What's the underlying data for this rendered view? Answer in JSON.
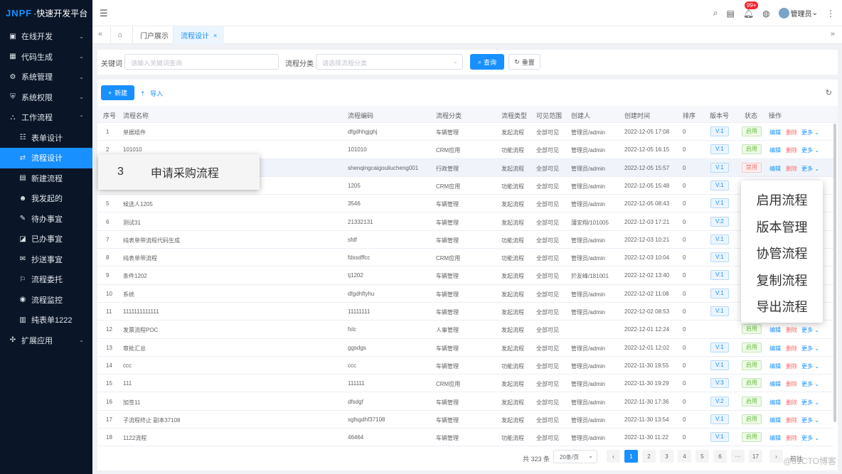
{
  "app": {
    "brand": "JNPF",
    "title": "·快速开发平台"
  },
  "sidebar": {
    "items": [
      {
        "label": "在线开发",
        "icon": "monitor-icon",
        "glyph": "▣",
        "chevron": "⌄",
        "sub": false,
        "active": false
      },
      {
        "label": "代码生成",
        "icon": "code-icon",
        "glyph": "▦",
        "chevron": "⌄",
        "sub": false,
        "active": false
      },
      {
        "label": "系统管理",
        "icon": "gear-icon",
        "glyph": "⚙",
        "chevron": "⌄",
        "sub": false,
        "active": false
      },
      {
        "label": "系统权限",
        "icon": "shield-icon",
        "glyph": "⛨",
        "chevron": "⌄",
        "sub": false,
        "active": false
      },
      {
        "label": "工作流程",
        "icon": "workflow-icon",
        "glyph": "⛬",
        "chevron": "⌃",
        "sub": false,
        "active": false
      },
      {
        "label": "表单设计",
        "icon": "form-icon",
        "glyph": "☷",
        "chevron": "",
        "sub": true,
        "active": false
      },
      {
        "label": "流程设计",
        "icon": "flow-design-icon",
        "glyph": "⇄",
        "chevron": "",
        "sub": true,
        "active": true
      },
      {
        "label": "新建流程",
        "icon": "new-flow-icon",
        "glyph": "▤",
        "chevron": "",
        "sub": true,
        "active": false
      },
      {
        "label": "我发起的",
        "icon": "user-icon",
        "glyph": "☻",
        "chevron": "",
        "sub": true,
        "active": false
      },
      {
        "label": "待办事宜",
        "icon": "todo-icon",
        "glyph": "✎",
        "chevron": "",
        "sub": true,
        "active": false
      },
      {
        "label": "已办事宜",
        "icon": "done-icon",
        "glyph": "◪",
        "chevron": "",
        "sub": true,
        "active": false
      },
      {
        "label": "抄送事宜",
        "icon": "cc-icon",
        "glyph": "✉",
        "chevron": "",
        "sub": true,
        "active": false
      },
      {
        "label": "流程委托",
        "icon": "delegate-icon",
        "glyph": "⚐",
        "chevron": "",
        "sub": true,
        "active": false
      },
      {
        "label": "流程监控",
        "icon": "monitor-flow-icon",
        "glyph": "◉",
        "chevron": "",
        "sub": true,
        "active": false
      },
      {
        "label": "纯表单1222",
        "icon": "doc-icon",
        "glyph": "▥",
        "chevron": "",
        "sub": true,
        "active": false
      },
      {
        "label": "扩展应用",
        "icon": "extend-icon",
        "glyph": "✣",
        "chevron": "⌄",
        "sub": false,
        "active": false
      }
    ]
  },
  "header": {
    "badge": "99+",
    "user": "管理员",
    "user_chev": "⌄"
  },
  "tabs": [
    {
      "label": "门户展示",
      "active": false
    },
    {
      "label": "流程设计",
      "active": true,
      "close": "×"
    }
  ],
  "search": {
    "keyword_label": "关键词",
    "keyword_placeholder": "请输入关键词查询",
    "category_label": "流程分类",
    "category_placeholder": "请选择流程分类",
    "query_button": "查询",
    "reset_button": "重置"
  },
  "toolbar": {
    "new_button": "新建",
    "import_button": "导入"
  },
  "table": {
    "columns": [
      "序号",
      "流程名称",
      "流程编码",
      "流程分类",
      "流程类型",
      "可见范围",
      "创建人",
      "创建时间",
      "排序",
      "版本号",
      "状态",
      "操作"
    ],
    "rows": [
      [
        "1",
        "单据组件",
        "dfgdhhgjghj",
        "车辆管理",
        "发起流程",
        "全部可见",
        "管理员/admin",
        "2022-12-05 17:08",
        "0",
        "V:1",
        "启用"
      ],
      [
        "2",
        "101010",
        "101010",
        "CRM应用",
        "功能流程",
        "全部可见",
        "管理员/admin",
        "2022-12-05 16:15",
        "0",
        "V:1",
        "启用"
      ],
      [
        "3",
        "申请采购流程",
        "shenqingcaigouliucheng001",
        "行政管理",
        "发起流程",
        "全部可见",
        "管理员/admin",
        "2022-12-05 15:57",
        "0",
        "V:1",
        "禁用"
      ],
      [
        "4",
        "",
        "1205",
        "CRM应用",
        "功能流程",
        "全部可见",
        "管理员/admin",
        "2022-12-05 15:48",
        "0",
        "V:1",
        ""
      ],
      [
        "5",
        "候选人1205",
        "3546",
        "车辆管理",
        "发起流程",
        "全部可见",
        "管理员/admin",
        "2022-12-05 08:43",
        "0",
        "V:1",
        ""
      ],
      [
        "6",
        "测试31",
        "21332131",
        "车辆管理",
        "发起流程",
        "全部可见",
        "蒲安翔/101005",
        "2022-12-03 17:21",
        "0",
        "V:2",
        ""
      ],
      [
        "7",
        "纯表单带流程代码生成",
        "sfdf",
        "车辆管理",
        "功能流程",
        "全部可见",
        "管理员/admin",
        "2022-12-03 10:21",
        "0",
        "V:1",
        ""
      ],
      [
        "8",
        "纯表单带流程",
        "fdssdffcc",
        "CRM应用",
        "功能流程",
        "全部可见",
        "管理员/admin",
        "2022-12-03 10:04",
        "0",
        "V:1",
        ""
      ],
      [
        "9",
        "条件1202",
        "tj1202",
        "车辆管理",
        "发起流程",
        "全部可见",
        "於友峰/181001",
        "2022-12-02 13:40",
        "0",
        "V:1",
        ""
      ],
      [
        "10",
        "系统",
        "dfgdhftyhu",
        "车辆管理",
        "发起流程",
        "全部可见",
        "管理员/admin",
        "2022-12-02 11:08",
        "0",
        "V:1",
        ""
      ],
      [
        "11",
        "1111111111111",
        "11111111",
        "车辆管理",
        "发起流程",
        "全部可见",
        "管理员/admin",
        "2022-12-02 08:53",
        "0",
        "V:1",
        ""
      ],
      [
        "12",
        "发票流程POC",
        "fxlc",
        "人事管理",
        "发起流程",
        "全部可见",
        "",
        "2022-12-01 12:24",
        "0",
        "",
        "启用"
      ],
      [
        "13",
        "审批汇总",
        "ggsdgs",
        "车辆管理",
        "发起流程",
        "全部可见",
        "管理员/admin",
        "2022-12-01 12:02",
        "0",
        "V:1",
        "启用"
      ],
      [
        "14",
        "ccc",
        "ccc",
        "车辆管理",
        "功能流程",
        "全部可见",
        "管理员/admin",
        "2022-11-30 19:55",
        "0",
        "V:1",
        "启用"
      ],
      [
        "15",
        "111",
        "111111",
        "CRM应用",
        "发起流程",
        "全部可见",
        "管理员/admin",
        "2022-11-30 19:29",
        "0",
        "V:3",
        "启用"
      ],
      [
        "16",
        "加签11",
        "dfsdgf",
        "车辆管理",
        "发起流程",
        "全部可见",
        "管理员/admin",
        "2022-11-30 17:36",
        "0",
        "V:2",
        "启用"
      ],
      [
        "17",
        "子流程终止 副本37108",
        "sgfsgdhf37108",
        "车辆管理",
        "发起流程",
        "全部可见",
        "管理员/admin",
        "2022-11-30 13:54",
        "0",
        "V:1",
        "启用"
      ],
      [
        "18",
        "1122流程",
        "46464",
        "车辆管理",
        "功能流程",
        "全部可见",
        "管理员/admin",
        "2022-11-30 11:22",
        "0",
        "V:1",
        "启用"
      ]
    ],
    "ops": {
      "edit": "编辑",
      "delete": "删除",
      "more": "更多 ⌄"
    }
  },
  "pagination": {
    "total": "共 323 条",
    "page_size": "20条/页",
    "pages": [
      "1",
      "2",
      "3",
      "4",
      "5",
      "6",
      "···",
      "17"
    ],
    "current": "1",
    "goto": "前往"
  },
  "callout": {
    "num": "3",
    "text": "申请采购流程"
  },
  "dropdown": [
    "启用流程",
    "版本管理",
    "协管流程",
    "复制流程",
    "导出流程"
  ],
  "watermark": "@51CTO博客"
}
